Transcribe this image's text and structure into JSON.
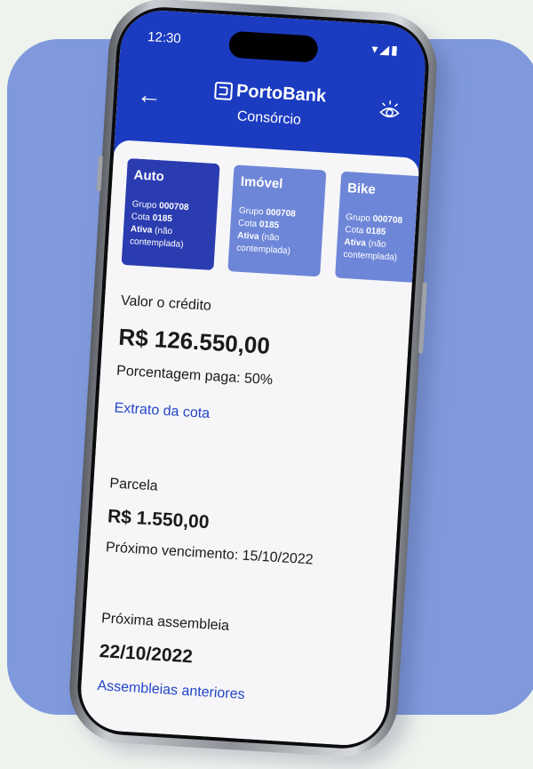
{
  "status_bar": {
    "time": "12:30",
    "icons": "▾◢▮"
  },
  "header": {
    "brand": "PortoBank",
    "subtitle": "Consórcio"
  },
  "cards": [
    {
      "title": "Auto",
      "grupo_label": "Grupo",
      "grupo": "000708",
      "cota_label": "Cota",
      "cota": "0185",
      "status_bold": "Ativa",
      "status_rest": "(não contemplada)"
    },
    {
      "title": "Imóvel",
      "grupo_label": "Grupo",
      "grupo": "000708",
      "cota_label": "Cota",
      "cota": "0185",
      "status_bold": "Ativa",
      "status_rest": "(não contemplada)"
    },
    {
      "title": "Bike",
      "grupo_label": "Grupo",
      "grupo": "000708",
      "cota_label": "Cota",
      "cota": "0185",
      "status_bold": "Ativa",
      "status_rest": "(não contemplada)"
    }
  ],
  "credit": {
    "label": "Valor o crédito",
    "value": "R$ 126.550,00",
    "percent": "Porcentagem paga: 50%",
    "link": "Extrato da cota"
  },
  "installment": {
    "label": "Parcela",
    "value": "R$ 1.550,00",
    "due": "Próximo vencimento: 15/10/2022"
  },
  "assembly": {
    "label": "Próxima assembleia",
    "date": "22/10/2022",
    "link": "Assembleias anteriores"
  }
}
